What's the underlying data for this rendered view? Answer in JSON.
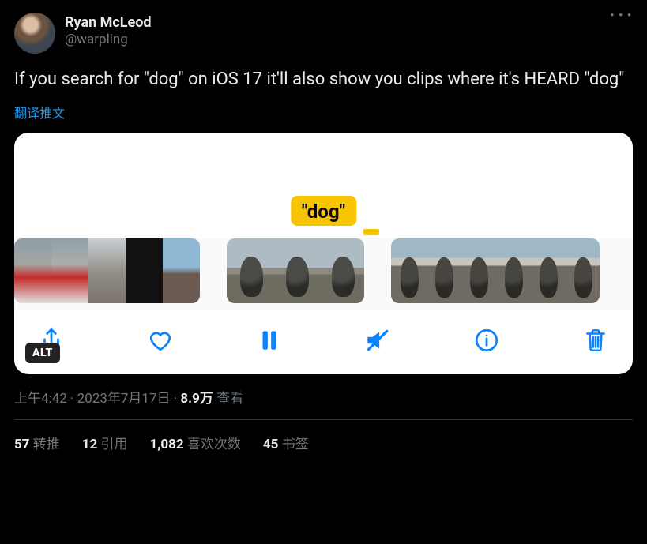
{
  "author": {
    "display_name": "Ryan McLeod",
    "handle": "@warpling"
  },
  "body": "If you search for \"dog\" on iOS 17 it'll also show you clips where it's HEARD \"dog\"",
  "translate_label": "翻译推文",
  "media": {
    "pill_text": "\"dog\"",
    "alt_badge": "ALT"
  },
  "meta": {
    "time": "上午4:42",
    "date": "2023年7月17日",
    "views_count": "8.9万",
    "views_label": "查看",
    "sep": " · "
  },
  "stats": {
    "retweets": {
      "count": "57",
      "label": "转推"
    },
    "quotes": {
      "count": "12",
      "label": "引用"
    },
    "likes": {
      "count": "1,082",
      "label": "喜欢次数"
    },
    "bookmarks": {
      "count": "45",
      "label": "书签"
    }
  }
}
